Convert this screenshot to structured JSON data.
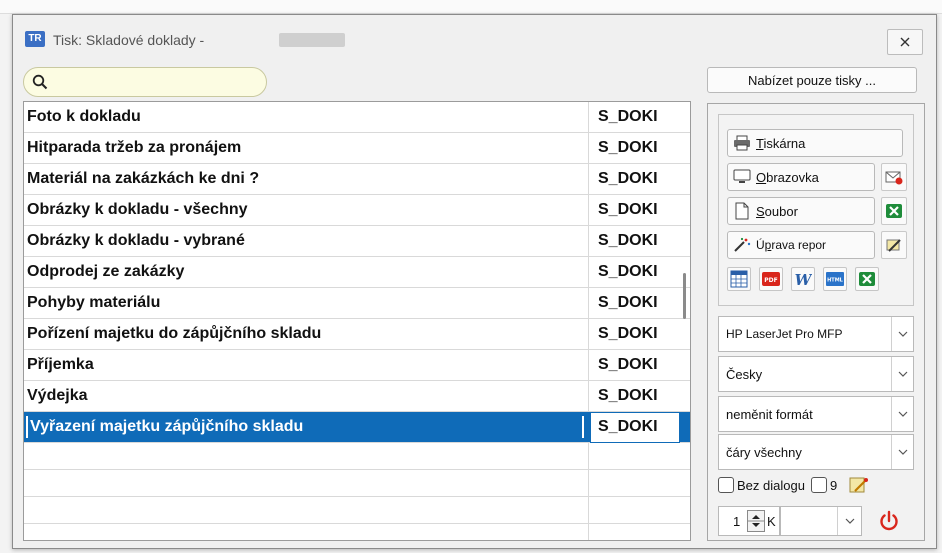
{
  "window": {
    "title": "Tisk: Skladové doklady - ",
    "app_icon_text": "TR"
  },
  "toolbar": {
    "offer_button": "Nabízet pouze tisky ..."
  },
  "list": {
    "rows": [
      {
        "name": "Foto k dokladu",
        "code": "S_DOKI"
      },
      {
        "name": "Hitparada tržeb za pronájem",
        "code": "S_DOKI"
      },
      {
        "name": "Materiál na zakázkách ke dni ?",
        "code": "S_DOKI"
      },
      {
        "name": "Obrázky k dokladu - všechny",
        "code": "S_DOKI"
      },
      {
        "name": "Obrázky k dokladu - vybrané",
        "code": "S_DOKI"
      },
      {
        "name": "Odprodej ze zakázky",
        "code": "S_DOKI"
      },
      {
        "name": "Pohyby materiálu",
        "code": "S_DOKI"
      },
      {
        "name": "Pořízení majetku do zápůjčního skladu",
        "code": "S_DOKI"
      },
      {
        "name": "Příjemka",
        "code": "S_DOKI"
      },
      {
        "name": "Výdejka",
        "code": "S_DOKI"
      },
      {
        "name": "Vyřazení majetku zápůjčního skladu",
        "code": "S_DOKI"
      }
    ],
    "selected_index": 10
  },
  "panel": {
    "printer_button_u": "T",
    "printer_button_rest": "iskárna",
    "screen_button_u": "O",
    "screen_button_rest": "brazovka",
    "file_button_u": "S",
    "file_button_rest": "oubor",
    "edit_button_pre": "Ú",
    "edit_button_u": "p",
    "edit_button_rest": "rava repor",
    "printer_select": "HP LaserJet Pro MFP",
    "language_select": "Česky",
    "format_select": "neměnit formát",
    "lines_select": "čáry všechny",
    "no_dialog_label": "Bez dialogu",
    "count_label": "9",
    "copies_value": "1",
    "copies_suffix": "K"
  },
  "colors": {
    "selection": "#0f6bb8",
    "search_bg": "#fcfce2",
    "excel_green": "#1e8c3a",
    "power_red": "#d9261c"
  }
}
